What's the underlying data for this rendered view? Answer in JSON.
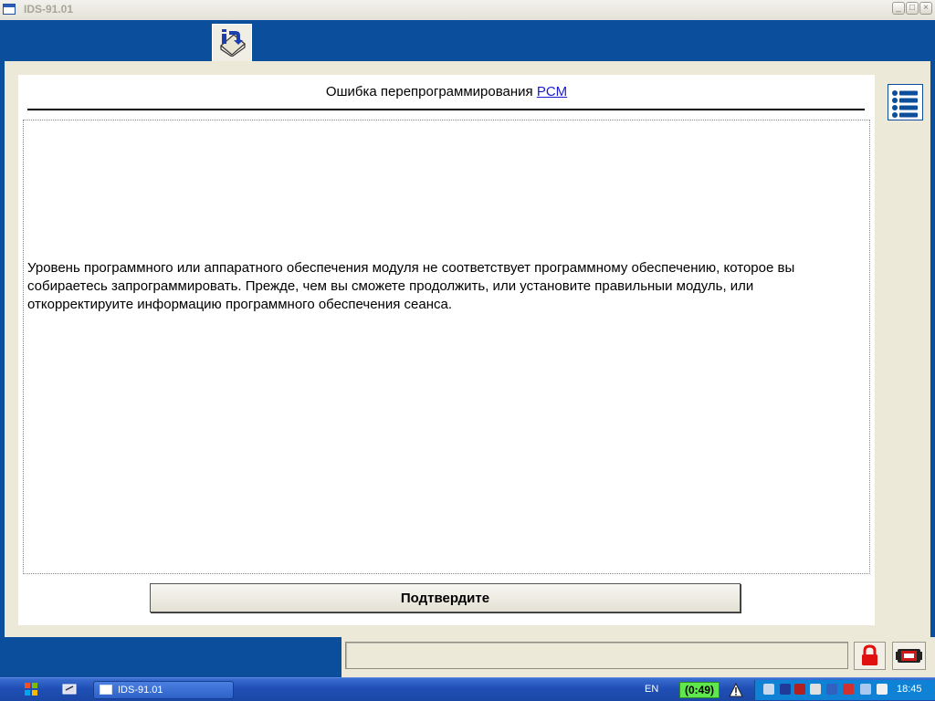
{
  "window": {
    "title": "IDS-91.01"
  },
  "page": {
    "title_prefix": "Ошибка перепрограммирования",
    "title_link": "PCM",
    "message": "Уровень программного или аппаратного обеспечения модуля не соответствует программному обеспечению, которое вы собираетесь запрограммировать. Прежде, чем вы сможете продолжить, или установите правильныи модуль, или откорректируите информацию программного обеспечения сеанса.",
    "confirm_label": "Подтвердите"
  },
  "icons": {
    "tab": "info-book-icon",
    "list": "list-icon",
    "lock": "lock-icon",
    "vcm": "vcm-device-icon"
  },
  "taskbar": {
    "task_label": "IDS-91.01",
    "language": "EN",
    "timer": "(0:49)",
    "clock": "18:45"
  },
  "colors": {
    "frame_blue": "#0b4f9c",
    "panel_bg": "#ece9d8",
    "link": "#1a1ad0",
    "timer_green": "#5ee84e",
    "lock_red": "#e01010"
  }
}
